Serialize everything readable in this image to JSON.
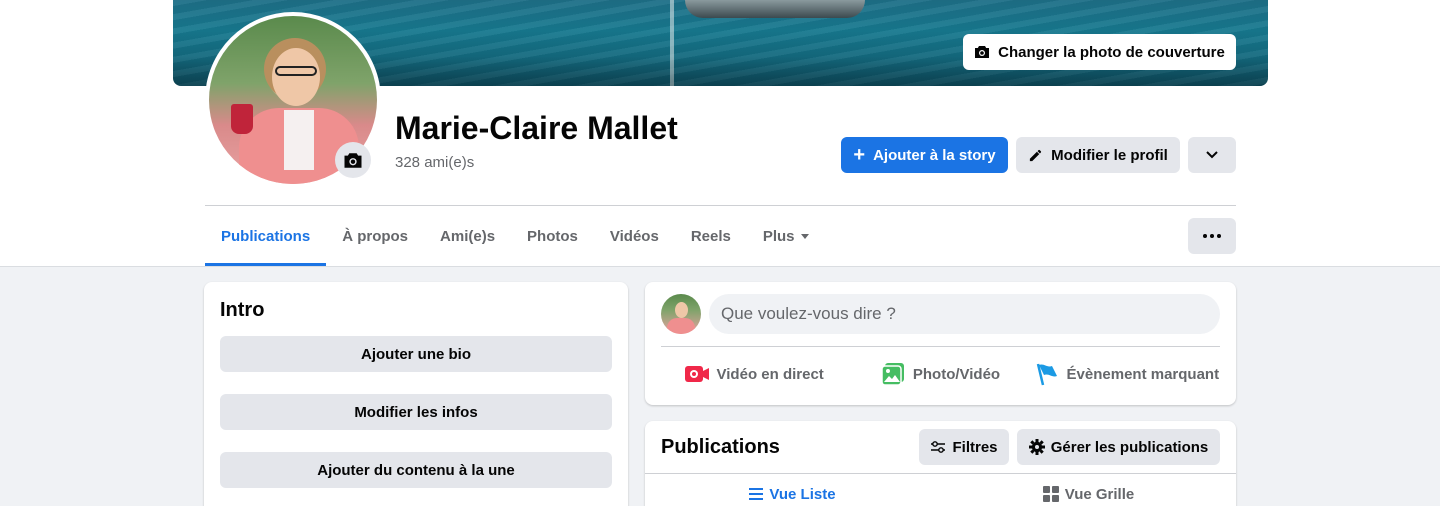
{
  "cover": {
    "change_photo_label": "Changer la photo de couverture"
  },
  "profile": {
    "name": "Marie-Claire Mallet",
    "friends": "328 ami(e)s"
  },
  "actions": {
    "add_story": "Ajouter à la story",
    "edit_profile": "Modifier le profil"
  },
  "tabs": [
    {
      "label": "Publications",
      "active": true
    },
    {
      "label": "À propos"
    },
    {
      "label": "Ami(e)s"
    },
    {
      "label": "Photos"
    },
    {
      "label": "Vidéos"
    },
    {
      "label": "Reels"
    },
    {
      "label": "Plus"
    }
  ],
  "intro": {
    "title": "Intro",
    "buttons": [
      "Ajouter une bio",
      "Modifier les infos",
      "Ajouter du contenu à la une"
    ]
  },
  "composer": {
    "placeholder": "Que voulez-vous dire ?",
    "actions": [
      "Vidéo en direct",
      "Photo/Vidéo",
      "Évènement marquant"
    ]
  },
  "posts": {
    "title": "Publications",
    "filters": "Filtres",
    "manage": "Gérer les publications",
    "view_list": "Vue Liste",
    "view_grid": "Vue Grille"
  },
  "colors": {
    "accent": "#1b74e4",
    "live": "#f02849",
    "photo": "#45bd62",
    "event": "#1b9ae4"
  }
}
